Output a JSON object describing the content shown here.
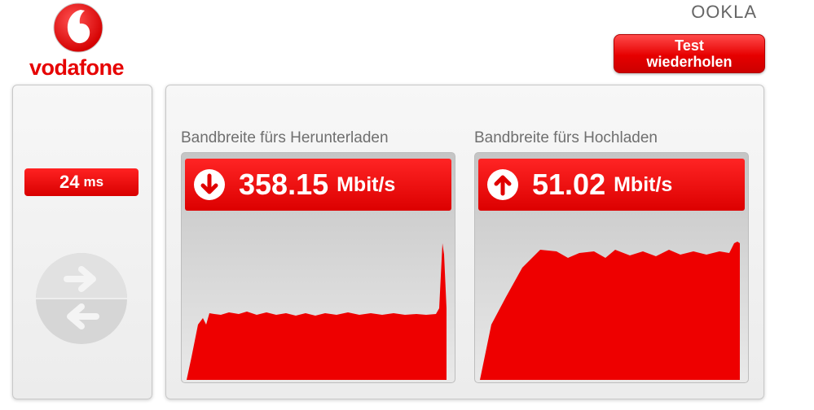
{
  "brand": {
    "name": "vodafone",
    "color": "#e60000"
  },
  "provider_logo": "OOKLA",
  "retest_button": {
    "line1": "Test",
    "line2": "wiederholen"
  },
  "ping": {
    "value": "24",
    "unit": "ms",
    "icon": "transfer-arrows-icon"
  },
  "download": {
    "title": "Bandbreite fürs Herunterladen",
    "value": "358.15",
    "unit": "Mbit/s",
    "icon": "arrow-down-icon"
  },
  "upload": {
    "title": "Bandbreite fürs Hochladen",
    "value": "51.02",
    "unit": "Mbit/s",
    "icon": "arrow-up-icon"
  }
}
